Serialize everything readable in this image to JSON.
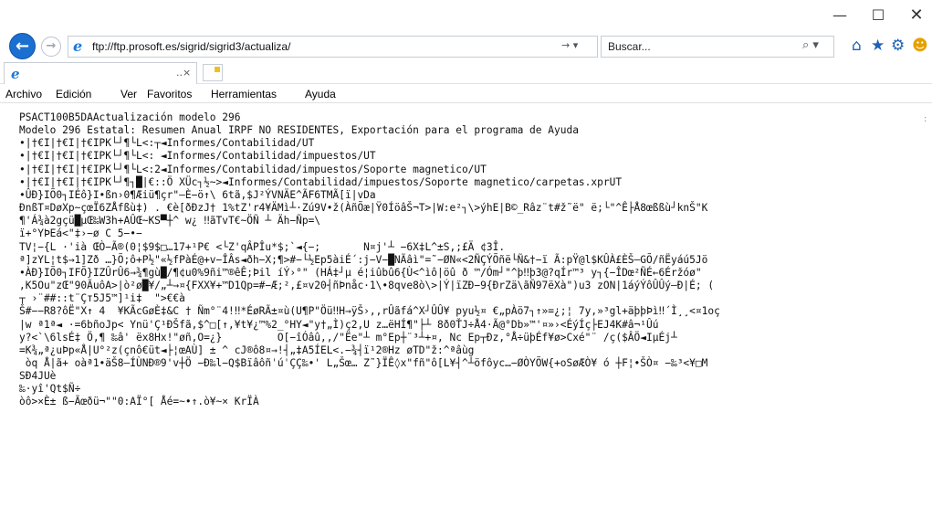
{
  "window": {
    "minimize": "—",
    "maximize": "☐",
    "close": "✕"
  },
  "toolbar": {
    "back_glyph": "←",
    "forward_glyph": "→",
    "address": "ftp://ftp.prosoft.es/sigrid/sigrid3/actualiza/",
    "address_controls": "→ ▾",
    "search_placeholder": "Buscar...",
    "search_glyph": "⌕ ▾",
    "home_glyph": "⌂",
    "star_glyph": "★",
    "gear_glyph": "⚙",
    "smile_glyph": "☻"
  },
  "tab": {
    "title": "",
    "close_glyph": "..×"
  },
  "menu": [
    "Archivo",
    "Edición",
    "Ver",
    "Favoritos",
    "Herramientas",
    "Ayuda"
  ],
  "content": {
    "lines": [
      "PSACT100B5DAActualización modelo 296",
      "Modelo 296 Estatal: Resumen Anual IRPF NO RESIDENTES, Exportación para el programa de Ayuda",
      "•|†€I|†€I|†€IPK└┘¶└L<:┬◄Informes/Contabilidad/UT",
      "•|†€I|†€I|†€IPK└┘¶└L<: ◄Informes/Contabilidad/impuestos/UT",
      "•|†€I|†€I|†€IPK└┘¶└L<:2◄Informes/Contabilidad/impuestos/Soporte magnetico/UT",
      "•|†€I|†€I|†€IPK└┘¶┐█|€::Ö XÜc┐½~>◄Informes/Contabilidad/impuestos/Soporte magnetico/carpetas.xprUT",
      "•ÛÐ}IÕ0┐IÉô}I•ßn›0¶Æiü¶çr\"–È−ö↑\\ 6tã,$J²ÝVNÄE^ÃF6TMÃ[ï|vDa",
      "ÐnßT¤DøXp~çœÏ6ZÅfßù‡) . €è[ðÐzJ† 1%tZ'r4¥ÄMì┴·Zú9V•ž(ÀñÕæ|Ÿ0ÍöâŠ¬T>|W:e²┐\\>ýhE|B©_Râz¨t#ž˜ë\" ë;└\"^Ê├Å8œßßù┘knŠ\"K",
      "¶'Á¾à2gçü█µŒ‰W3h+AÛŒ~KS▀┼^ w¿ ‼ãTvT€~ÖÑ ┴ Äh−Ñp=\\",
      "ï+°YÞEá<\"‡›−ø C 5−•−",
      "TV¦−{L ·'ià ŒÒ−Ã®(0¦$9$□…17+¹P€ <└Z'qÂPÎu*$;`◄{−;       N¤j'┴ −6X‡L^±S,;£Ä ¢3Î.",
      "ª]zYL¦t$→1]Zð …}Õ;ô+P½\"«½fPàÉ@+v−ÎÂs◄ðh−X;¶>#−└½Ep5àiÉ´:j−V−█NÃâì\"=˜−ØN«<2ÑÇÝÕñë└Ñ&†−ï Ã:pŸ@l$KÛÀ£ÈŠ—GÕ/ñËyáú5Jö",
      "•ÀÐ}IÕ0┐IFÕ}IZÛrÛ6→¾¶gù█/¶¢u0%9ñi™®êÊ;Þil íÝ›°\" (HÁ‡┘µ é¦iûbû6{Ù<^ìô|öû ð ™/Óm┘\"^þ‼þ3@?qÍr™³ y┐{−ÎDœ²ÑÉ←6Éržóø\"",
      ",K5Ou\"zŒ\"90ÃuôA>|ò²ø█¥/„┴→¤{FXX¥+™D1Qp=#−Æ;²,£¤v20┤ñÞnåc·1\\•8qve8ò\\>|Ý|ïZÐ−9{ÐrZä\\ãÑ97ëXà\")u3 zON|1áýÝôÛÛý—Ð|É; (",
      "┬ ›¨##::t¨Çт5J5™]¹i‡  \">€€à",
      "Š#−−R8?ôË\"X↑ 4  ¥KÃcGøÈ‡&C † Ñm°¨4!‼*ÉøRÃ±¤ù(U¶P\"Öü‼H→ÿŠ›,,rÛãfá^X┘ÛÛ¥ pyu½¤ €„pÀö7┐↑»=¿;¦ 7y,»³gl+äþþÞì‼´Ì¸¸<¤1oç",
      "|w ª1ª◄ ·=6bñoJp< Ynü'Ç¹ÐŠfã,$^□[↑,¥t¥¿™%2_°HY◄\"y†„Ì)ç2,U z…ëHÍ¶\"├┴ 8ð0ŤJ÷Å4·Ã@°Db»™'¤»›<ÉýÍç├EJ4K#â¬¹Ûú",
      "y?<`\\6lsÉ‡ Ö,¶ ‰â' ëx8Hx!\"øñ,O=¿}         O[−îÓâû,,/\"Ëe\"┴ m°Ep┼¨³┴+¤, Nc Ep┬Ðz,°Å÷üþÉf¥ø>Cxé\"¨ /ç($ÂÖ◄IµÉj┴",
      "=K¾„ª¿uÞp«Å|U°²z(çnô€üt◄├¦œAÙ] ± ^ cJ®ô8¤→!┤„‡A5ÍEL<.−¾┤ï¹2®Hz øTD\"ž:^ªâùg",
      " òq Å|ã+ oàª1•äŠ8—ÍÙNÐ®9'v┼Ö −Ð‰l−Q$BïâôñˈúˈÇÇ‰•' L„Šœ… Z˜}ÏÊ◊x\"fñ\"ô[L¥┤^┴öfôyc…−ØÒYÕW{+oSøÆÒ¥ ó ┼F¦•ŠÒ¤ −‰³<¥□M",
      "SÐ4JUè",
      "‰·yî'Qt$Ñ÷",
      "òô>×È± ß−Ãœðü¬\"\"0:AÏ°[ Åé=~•↑.ò¥~× KrÏÀ"
    ]
  }
}
